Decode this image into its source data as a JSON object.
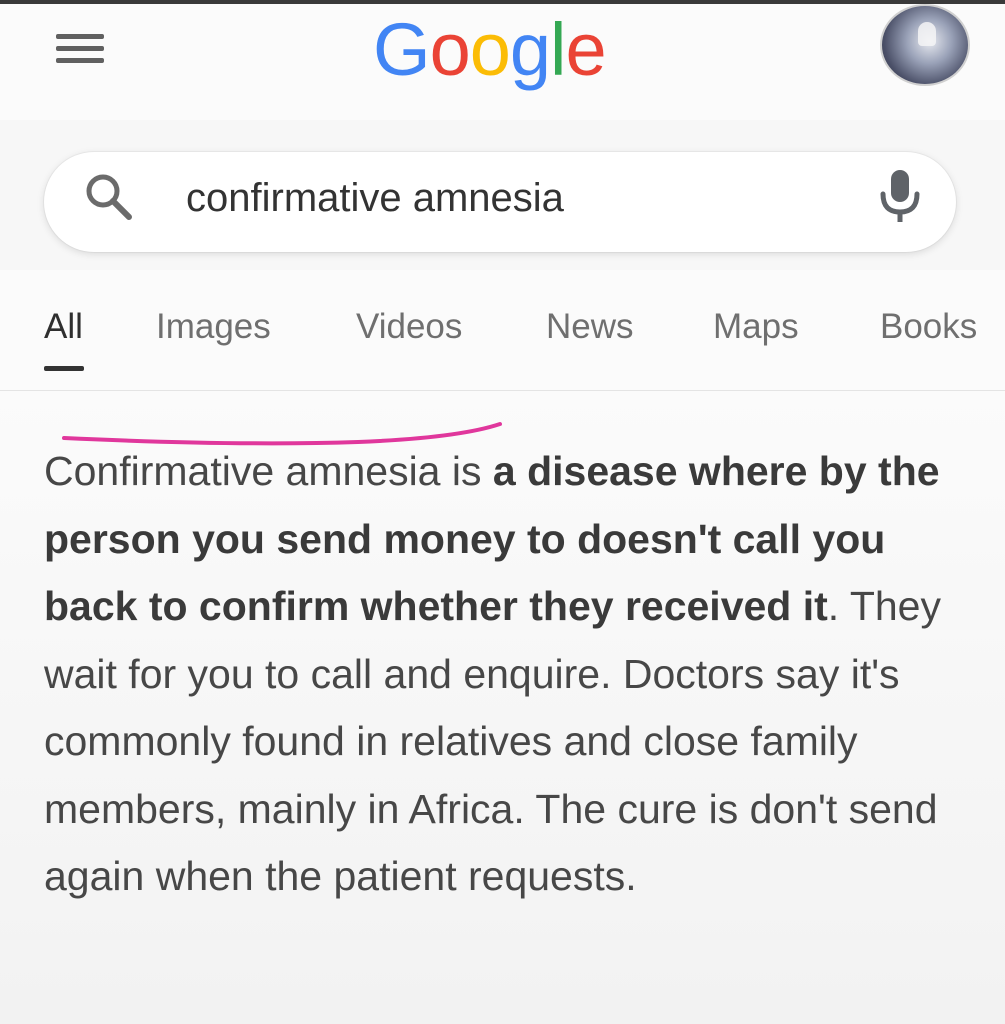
{
  "header": {
    "logo_letters": [
      "G",
      "o",
      "o",
      "g",
      "l",
      "e"
    ],
    "brand_colors": {
      "blue": "#4285F4",
      "red": "#EA4335",
      "yellow": "#FBBC05",
      "green": "#34A853"
    },
    "menu_icon": "hamburger-menu-icon",
    "avatar_icon": "profile-avatar"
  },
  "search": {
    "query": "confirmative amnesia",
    "search_icon": "search-icon",
    "mic_icon": "mic-icon"
  },
  "tabs": [
    {
      "label": "All",
      "active": true
    },
    {
      "label": "Images",
      "active": false
    },
    {
      "label": "Videos",
      "active": false
    },
    {
      "label": "News",
      "active": false
    },
    {
      "label": "Maps",
      "active": false
    },
    {
      "label": "Books",
      "active": false
    }
  ],
  "result": {
    "segments": [
      {
        "text": "Confirmative amnesia is ",
        "bold": false
      },
      {
        "text": "a disease where by the person you send money to doesn't call you back to confirm whether they received it",
        "bold": true
      },
      {
        "text": ". They wait for you to call and enquire. Doctors say it's commonly found in relatives and close family members, mainly in Africa. The cure is don't send again when the patient requests.",
        "bold": false
      }
    ]
  },
  "annotation": {
    "color": "#e0379c"
  }
}
